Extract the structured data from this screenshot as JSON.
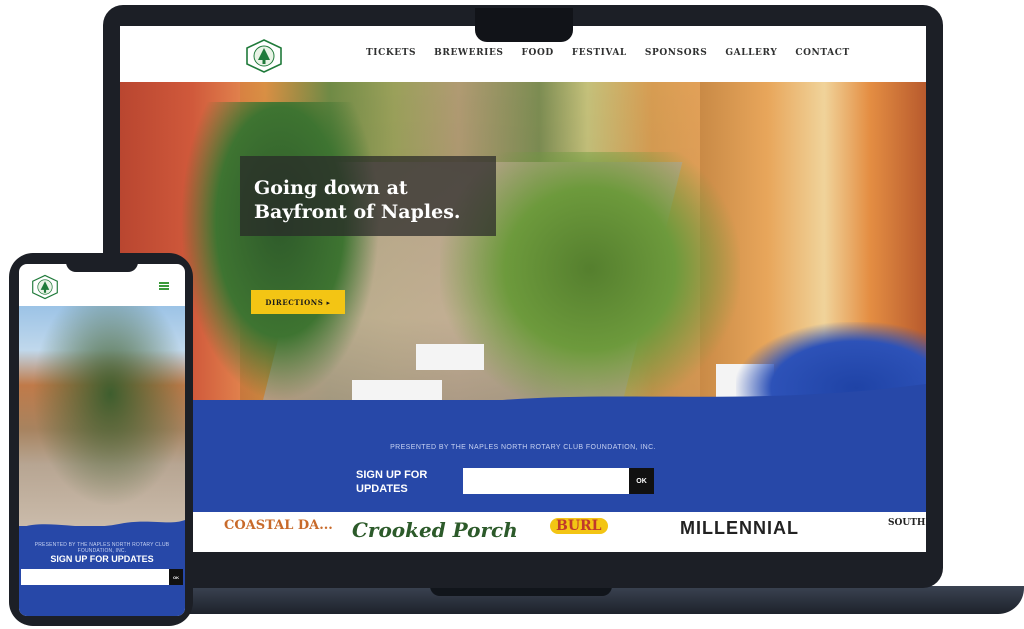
{
  "desktop": {
    "nav": {
      "items": [
        "TICKETS",
        "BREWERIES",
        "FOOD",
        "FESTIVAL",
        "SPONSORS",
        "GALLERY",
        "CONTACT"
      ]
    },
    "hero": {
      "title": "Going down at\nBayfront of Naples.",
      "button_label": "DIRECTIONS ▸"
    },
    "newsletter": {
      "presented_by": "PRESENTED BY THE NAPLES NORTH ROTARY CLUB FOUNDATION, INC.",
      "signup_label": "SIGN UP FOR UPDATES",
      "ok_label": "OK"
    },
    "sponsors": [
      "COASTAL DA...",
      "Crooked Porch",
      "BURL",
      "MILLENNIAL",
      "SOUTHERN"
    ]
  },
  "mobile": {
    "presented_by": "PRESENTED BY THE NAPLES NORTH ROTARY CLUB FOUNDATION, INC.",
    "signup_label": "SIGN UP FOR UPDATES",
    "ok_label": "OK"
  },
  "colors": {
    "brand_blue": "#2748a8",
    "accent_yellow": "#f3c514",
    "logo_green": "#1f7a3a"
  }
}
